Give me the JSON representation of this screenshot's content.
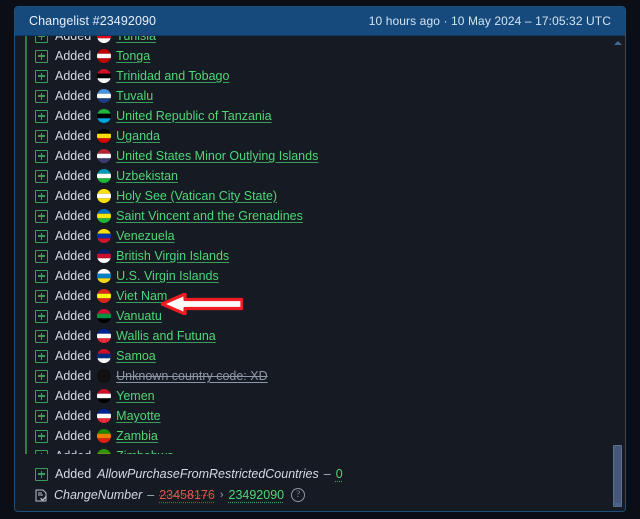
{
  "header": {
    "title": "Changelist #23492090",
    "meta": "10 hours ago · 10 May 2024 – 17:05:32 UTC"
  },
  "list": {
    "verb": "Added",
    "items": [
      {
        "name": "Tunisia",
        "flag": "tn",
        "unknown": false
      },
      {
        "name": "Tonga",
        "flag": "to",
        "unknown": false
      },
      {
        "name": "Trinidad and Tobago",
        "flag": "tt",
        "unknown": false
      },
      {
        "name": "Tuvalu",
        "flag": "tv",
        "unknown": false
      },
      {
        "name": "United Republic of Tanzania",
        "flag": "tz",
        "unknown": false
      },
      {
        "name": "Uganda",
        "flag": "ug",
        "unknown": false
      },
      {
        "name": "United States Minor Outlying Islands",
        "flag": "um",
        "unknown": false
      },
      {
        "name": "Uzbekistan",
        "flag": "uz",
        "unknown": false
      },
      {
        "name": "Holy See (Vatican City State)",
        "flag": "va",
        "unknown": false
      },
      {
        "name": "Saint Vincent and the Grenadines",
        "flag": "vc",
        "unknown": false
      },
      {
        "name": "Venezuela",
        "flag": "ve",
        "unknown": false
      },
      {
        "name": "British Virgin Islands",
        "flag": "vg",
        "unknown": false
      },
      {
        "name": "U.S. Virgin Islands",
        "flag": "vi",
        "unknown": false
      },
      {
        "name": "Viet Nam",
        "flag": "vn",
        "unknown": false
      },
      {
        "name": "Vanuatu",
        "flag": "vu",
        "unknown": false
      },
      {
        "name": "Wallis and Futuna",
        "flag": "wf",
        "unknown": false
      },
      {
        "name": "Samoa",
        "flag": "ws",
        "unknown": false
      },
      {
        "name": "Unknown country code: XD",
        "flag": "xd",
        "unknown": true
      },
      {
        "name": "Yemen",
        "flag": "ye",
        "unknown": false
      },
      {
        "name": "Mayotte",
        "flag": "yt",
        "unknown": false
      },
      {
        "name": "Zambia",
        "flag": "zm",
        "unknown": false
      },
      {
        "name": "Zimbabwe",
        "flag": "zw",
        "unknown": false
      }
    ]
  },
  "footer": {
    "added_verb": "Added",
    "allow_key": "AllowPurchaseFromRestrictedCountries",
    "allow_dash": "–",
    "allow_value": "0",
    "change_key": "ChangeNumber",
    "change_dash": "–",
    "change_old": "23458176",
    "change_sep": "›",
    "change_new": "23492090",
    "info_glyph": "?"
  },
  "annotation": {
    "kind": "left-pointing-arrow",
    "target": "Viet Nam",
    "fill": "#ffffff",
    "stroke": "#ee1c22"
  },
  "colors": {
    "header_bg": "#164a7d",
    "panel_bg": "#151a23",
    "page_bg": "#0b0e14",
    "added_green": "#4fd675",
    "removed_red": "#e8554e",
    "rail_green": "#2f7d45",
    "border_blue": "#1d4f7c"
  },
  "scrollbar": {
    "up_arrow": "scroll-up",
    "down_arrow": "scroll-down",
    "thumb": "scroll-thumb"
  }
}
